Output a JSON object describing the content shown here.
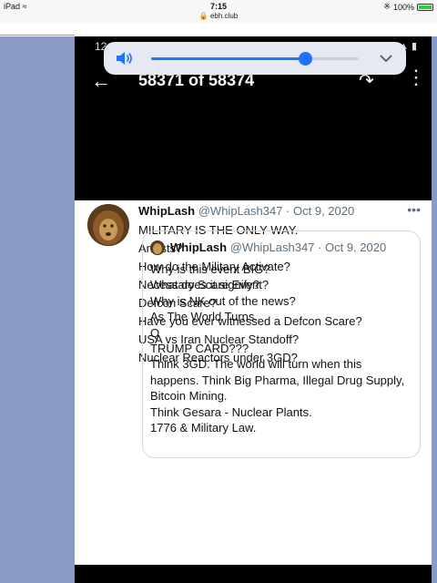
{
  "ios_status": {
    "device": "iPad",
    "time": "7:15",
    "url": "ebh.club",
    "battery": "100%"
  },
  "android_status": {
    "time": "12"
  },
  "viewer": {
    "title": "58371 of 58374"
  },
  "volume": {
    "level": 0.74,
    "accent": "#1e73ff"
  },
  "tweet": {
    "name": "WhipLash",
    "handle": "@WhipLash347",
    "date": "· Oct 9, 2020",
    "lines": [
      "MILITARY IS THE ONLY WAY.",
      "Arrests?",
      "How do the Military Activate?",
      "Necessary Scare Event?",
      "Defcon Scare?",
      "Have you ever witnessed a Defcon Scare?",
      "USA vs Iran Nuclear Standoff?",
      "Nuclear Reactors under 3GD?"
    ]
  },
  "quote": {
    "name": "WhipLash",
    "handle": "@WhipLash347",
    "date": "· Oct 9, 2020",
    "lines": [
      "Why is this event BIG?",
      "What does it signify?",
      "Why is NK out of the news?",
      "As The World Turns.",
      "Q",
      "TRUMP CARD???",
      "Think 3GD. The world will turn when this",
      "happens. Think Big Pharma, Illegal Drug Supply,",
      "Bitcoin Mining.",
      "Think Gesara - Nuclear Plants.",
      "1776 & Military Law."
    ]
  }
}
